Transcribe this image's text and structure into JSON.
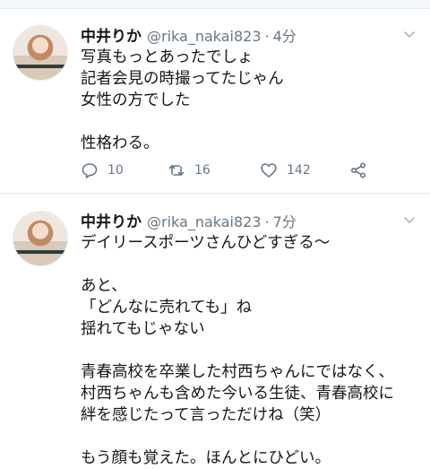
{
  "tweets": [
    {
      "name": "中井りか",
      "handle": "@rika_nakai823",
      "separator": "·",
      "time": "4分",
      "text": "写真もっとあったでしょ\n記者会見の時撮ってたじゃん\n女性の方でした\n\n性格わる。",
      "replies": "10",
      "retweets": "16",
      "likes": "142"
    },
    {
      "name": "中井りか",
      "handle": "@rika_nakai823",
      "separator": "·",
      "time": "7分",
      "text": "デイリースポーツさんひどすぎる〜\n\nあと、\n「どんなに売れても」ね\n揺れてもじゃない\n\n青春高校を卒業した村西ちゃんにではなく、\n村西ちゃんも含めた今いる生徒、青春高校に\n絆を感じたって言っただけね（笑）\n\nもう顔も覚えた。ほんとにひどい。"
    }
  ],
  "icons": {
    "reply": "reply-icon",
    "retweet": "retweet-icon",
    "like": "heart-icon",
    "share": "share-icon",
    "more": "chevron-down-icon"
  },
  "colors": {
    "text": "#14171a",
    "secondary": "#657786",
    "divider": "#e6ecf0"
  }
}
